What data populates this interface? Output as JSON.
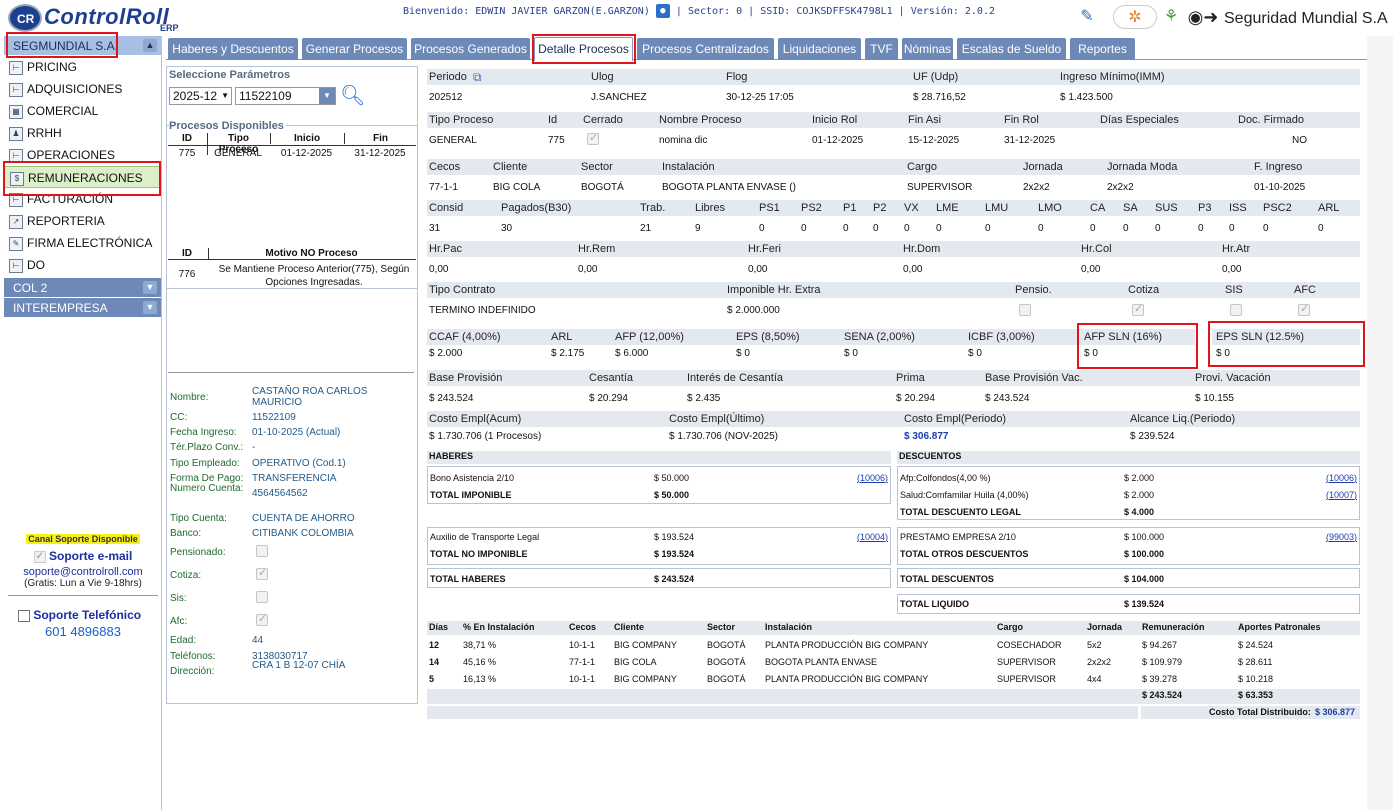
{
  "header": {
    "brand": "ControlRoll",
    "brand_initials": "CR",
    "erp": "ERP",
    "welcome": "Bienvenido: EDWIN JAVIER GARZON(E.GARZON)",
    "session": "| Sector: 0 | SSID: COJKSDFFSK4798L1 | Versión: 2.0.2",
    "company": "Seguridad Mundial S.A"
  },
  "sidebar": {
    "top_section": "SEGMUNDIAL S.A.",
    "items": [
      {
        "label": "PRICING",
        "icon": "tree-icon"
      },
      {
        "label": "ADQUISICIONES",
        "icon": "tree-icon"
      },
      {
        "label": "COMERCIAL",
        "icon": "grid-icon"
      },
      {
        "label": "RRHH",
        "icon": "people-icon"
      },
      {
        "label": "OPERACIONES",
        "icon": "tree-icon"
      },
      {
        "label": "REMUNERACIONES",
        "icon": "money-icon"
      },
      {
        "label": "FACTURACIÓN",
        "icon": "tree-icon"
      },
      {
        "label": "REPORTERIA",
        "icon": "chart-icon"
      },
      {
        "label": "FIRMA ELECTRÓNICA",
        "icon": "doc-icon"
      },
      {
        "label": "DO",
        "icon": "tree-icon"
      }
    ],
    "sections": [
      "COL 2",
      "INTEREMPRESA"
    ],
    "support": {
      "channel": "Canal Soporte Disponible",
      "email_title": "Soporte e-mail",
      "email": "soporte@controlroll.com",
      "hours": "(Gratis: Lun a Vie 9-18hrs)",
      "phone_title": "Soporte Telefónico",
      "phone": "601 4896883"
    }
  },
  "tabs": [
    "Haberes y Descuentos",
    "Generar Procesos",
    "Procesos Generados",
    "Detalle Procesos",
    "Procesos Centralizados",
    "Liquidaciones",
    "TVF",
    "Nóminas",
    "Escalas de Sueldo",
    "Reportes"
  ],
  "params": {
    "title": "Seleccione Parámetros",
    "period": "2025-12",
    "code": "11522109"
  },
  "procesos": {
    "title": "Procesos Disponibles",
    "headers": [
      "ID",
      "Tipo Proceso",
      "Inicio",
      "Fin"
    ],
    "row": [
      "775",
      "GENERAL",
      "01-12-2025",
      "31-12-2025"
    ],
    "no_headers": [
      "ID",
      "Motivo NO Proceso"
    ],
    "no_row": [
      "776",
      "Se Mantiene Proceso Anterior(775), Según Opciones Ingresadas."
    ]
  },
  "employee": {
    "fields": [
      {
        "k": "Nombre:",
        "v": "CASTAÑO ROA CARLOS MAURICIO"
      },
      {
        "k": "CC:",
        "v": "11522109"
      },
      {
        "k": "Fecha Ingreso:",
        "v": "01-10-2025 (Actual)"
      },
      {
        "k": "Tér.Plazo Conv.:",
        "v": "-"
      },
      {
        "k": "Tipo Empleado:",
        "v": "OPERATIVO (Cod.1)"
      },
      {
        "k": "Forma De Pago:",
        "v": "TRANSFERENCIA"
      },
      {
        "k": "Numero Cuenta:",
        "v": "4564564562"
      },
      {
        "k": "Tipo Cuenta:",
        "v": "CUENTA DE AHORRO"
      },
      {
        "k": "Banco:",
        "v": "CITIBANK COLOMBIA"
      },
      {
        "k": "Pensionado:",
        "v": ""
      },
      {
        "k": "Cotiza:",
        "v": ""
      },
      {
        "k": "Sis:",
        "v": ""
      },
      {
        "k": "Afc:",
        "v": ""
      },
      {
        "k": "Edad:",
        "v": "44"
      },
      {
        "k": "Teléfonos:",
        "v": "3138030717"
      },
      {
        "k": "Dirección:",
        "v": "CRA 1 B 12-07 CHÍA"
      }
    ]
  },
  "detail": {
    "r1": {
      "labels": [
        "Periodo",
        "Ulog",
        "Flog",
        "UF (Udp)",
        "Ingreso Mínimo(IMM)"
      ],
      "values": [
        "202512",
        "J.SANCHEZ",
        "30-12-25 17:05",
        "$ 28.716,52",
        "$ 1.423.500"
      ]
    },
    "r2": {
      "labels": [
        "Tipo Proceso",
        "Id",
        "Cerrado",
        "Nombre Proceso",
        "Inicio Rol",
        "Fin Asi",
        "Fin Rol",
        "Días Especiales",
        "Doc. Firmado"
      ],
      "values": [
        "GENERAL",
        "775",
        "",
        "nomina dic",
        "01-12-2025",
        "15-12-2025",
        "31-12-2025",
        "",
        "NO"
      ]
    },
    "r3": {
      "labels": [
        "Cecos",
        "Cliente",
        "Sector",
        "Instalación",
        "Cargo",
        "Jornada",
        "Jornada Moda",
        "F. Ingreso"
      ],
      "values": [
        "77-1-1",
        "BIG COLA",
        "BOGOTÁ",
        "BOGOTA PLANTA ENVASE ()",
        "SUPERVISOR",
        "2x2x2",
        "2x2x2",
        "01-10-2025"
      ]
    },
    "r4": {
      "labels": [
        "Consid",
        "Pagados(B30)",
        "Trab.",
        "Libres",
        "PS1",
        "PS2",
        "P1",
        "P2",
        "VX",
        "LME",
        "LMU",
        "LMO",
        "CA",
        "SA",
        "SUS",
        "P3",
        "ISS",
        "PSC2",
        "ARL"
      ],
      "values": [
        "31",
        "30",
        "21",
        "9",
        "0",
        "0",
        "0",
        "0",
        "0",
        "0",
        "0",
        "0",
        "0",
        "0",
        "0",
        "0",
        "0",
        "0",
        "0"
      ]
    },
    "r5": {
      "labels": [
        "Hr.Pac",
        "Hr.Rem",
        "Hr.Feri",
        "Hr.Dom",
        "Hr.Col",
        "Hr.Atr"
      ],
      "values": [
        "0,00",
        "0,00",
        "0,00",
        "0,00",
        "0,00",
        "0,00"
      ]
    },
    "r6": {
      "labels": [
        "Tipo Contrato",
        "Imponible Hr. Extra",
        "Pensio.",
        "Cotiza",
        "SIS",
        "AFC"
      ],
      "values": [
        "TERMINO INDEFINIDO",
        "$ 2.000.000"
      ]
    },
    "r7": {
      "labels": [
        "CCAF (4,00%)",
        "ARL",
        "AFP (12,00%)",
        "EPS (8,50%)",
        "SENA (2,00%)",
        "ICBF (3,00%)",
        "AFP SLN (16%)",
        "EPS SLN (12.5%)"
      ],
      "values": [
        "$ 2.000",
        "$ 2.175",
        "$ 6.000",
        "$ 0",
        "$ 0",
        "$ 0",
        "$ 0",
        "$ 0"
      ]
    },
    "r8": {
      "labels": [
        "Base Provisión",
        "Cesantía",
        "Interés de Cesantía",
        "Prima",
        "Base Provisión Vac.",
        "Provi. Vacación"
      ],
      "values": [
        "$ 243.524",
        "$ 20.294",
        "$ 2.435",
        "$ 20.294",
        "$ 243.524",
        "$ 10.155"
      ]
    },
    "r9": {
      "labels": [
        "Costo Empl(Acum)",
        "Costo Empl(Último)",
        "Costo Empl(Periodo)",
        "Alcance Liq.(Periodo)"
      ],
      "values": [
        "$ 1.730.706 (1 Procesos)",
        "$ 1.730.706 (NOV-2025)",
        "$ 306.877",
        "$ 239.524"
      ]
    }
  },
  "haberes": {
    "title": "HABERES",
    "imponible": [
      {
        "name": "Bono Asistencia 2/10",
        "amount": "$ 50.000",
        "code": "10006"
      }
    ],
    "total_imponible": {
      "label": "TOTAL IMPONIBLE",
      "amount": "$ 50.000"
    },
    "no_imponible": [
      {
        "name": "Auxilio de Transporte Legal",
        "amount": "$ 193.524",
        "code": "10004"
      }
    ],
    "total_no_imponible": {
      "label": "TOTAL NO IMPONIBLE",
      "amount": "$ 193.524"
    },
    "total": {
      "label": "TOTAL HABERES",
      "amount": "$ 243.524"
    }
  },
  "descuentos": {
    "title": "DESCUENTOS",
    "legal": [
      {
        "name": "Afp:Colfondos(4,00 %)",
        "amount": "$ 2.000",
        "code": "10006"
      },
      {
        "name": "Salud:Comfamilar Huila (4,00%)",
        "amount": "$ 2.000",
        "code": "10007"
      }
    ],
    "total_legal": {
      "label": "TOTAL DESCUENTO LEGAL",
      "amount": "$ 4.000"
    },
    "otros": [
      {
        "name": "PRESTAMO EMPRESA 2/10",
        "amount": "$ 100.000",
        "code": "99003"
      }
    ],
    "total_otros": {
      "label": "TOTAL OTROS DESCUENTOS",
      "amount": "$ 100.000"
    },
    "total": {
      "label": "TOTAL DESCUENTOS",
      "amount": "$ 104.000"
    },
    "liquido": {
      "label": "TOTAL LIQUIDO",
      "amount": "$ 139.524"
    }
  },
  "distribution": {
    "headers": [
      "Días",
      "% En Instalación",
      "Cecos",
      "Cliente",
      "Sector",
      "Instalación",
      "Cargo",
      "Jornada",
      "Remuneración",
      "Aportes Patronales"
    ],
    "rows": [
      [
        "12",
        "38,71 %",
        "10-1-1",
        "BIG COMPANY",
        "BOGOTÁ",
        "PLANTA PRODUCCIÓN BIG COMPANY",
        "COSECHADOR",
        "5x2",
        "$ 94.267",
        "$ 24.524"
      ],
      [
        "14",
        "45,16 %",
        "77-1-1",
        "BIG COLA",
        "BOGOTÁ",
        "BOGOTA PLANTA ENVASE",
        "SUPERVISOR",
        "2x2x2",
        "$ 109.979",
        "$ 28.611"
      ],
      [
        "5",
        "16,13 %",
        "10-1-1",
        "BIG COMPANY",
        "BOGOTÁ",
        "PLANTA PRODUCCIÓN BIG COMPANY",
        "SUPERVISOR",
        "4x4",
        "$ 39.278",
        "$ 10.218"
      ]
    ],
    "totals": [
      "$ 243.524",
      "$ 63.353"
    ],
    "cost_label": "Costo Total Distribuido:",
    "cost_value": "$ 306.877"
  }
}
